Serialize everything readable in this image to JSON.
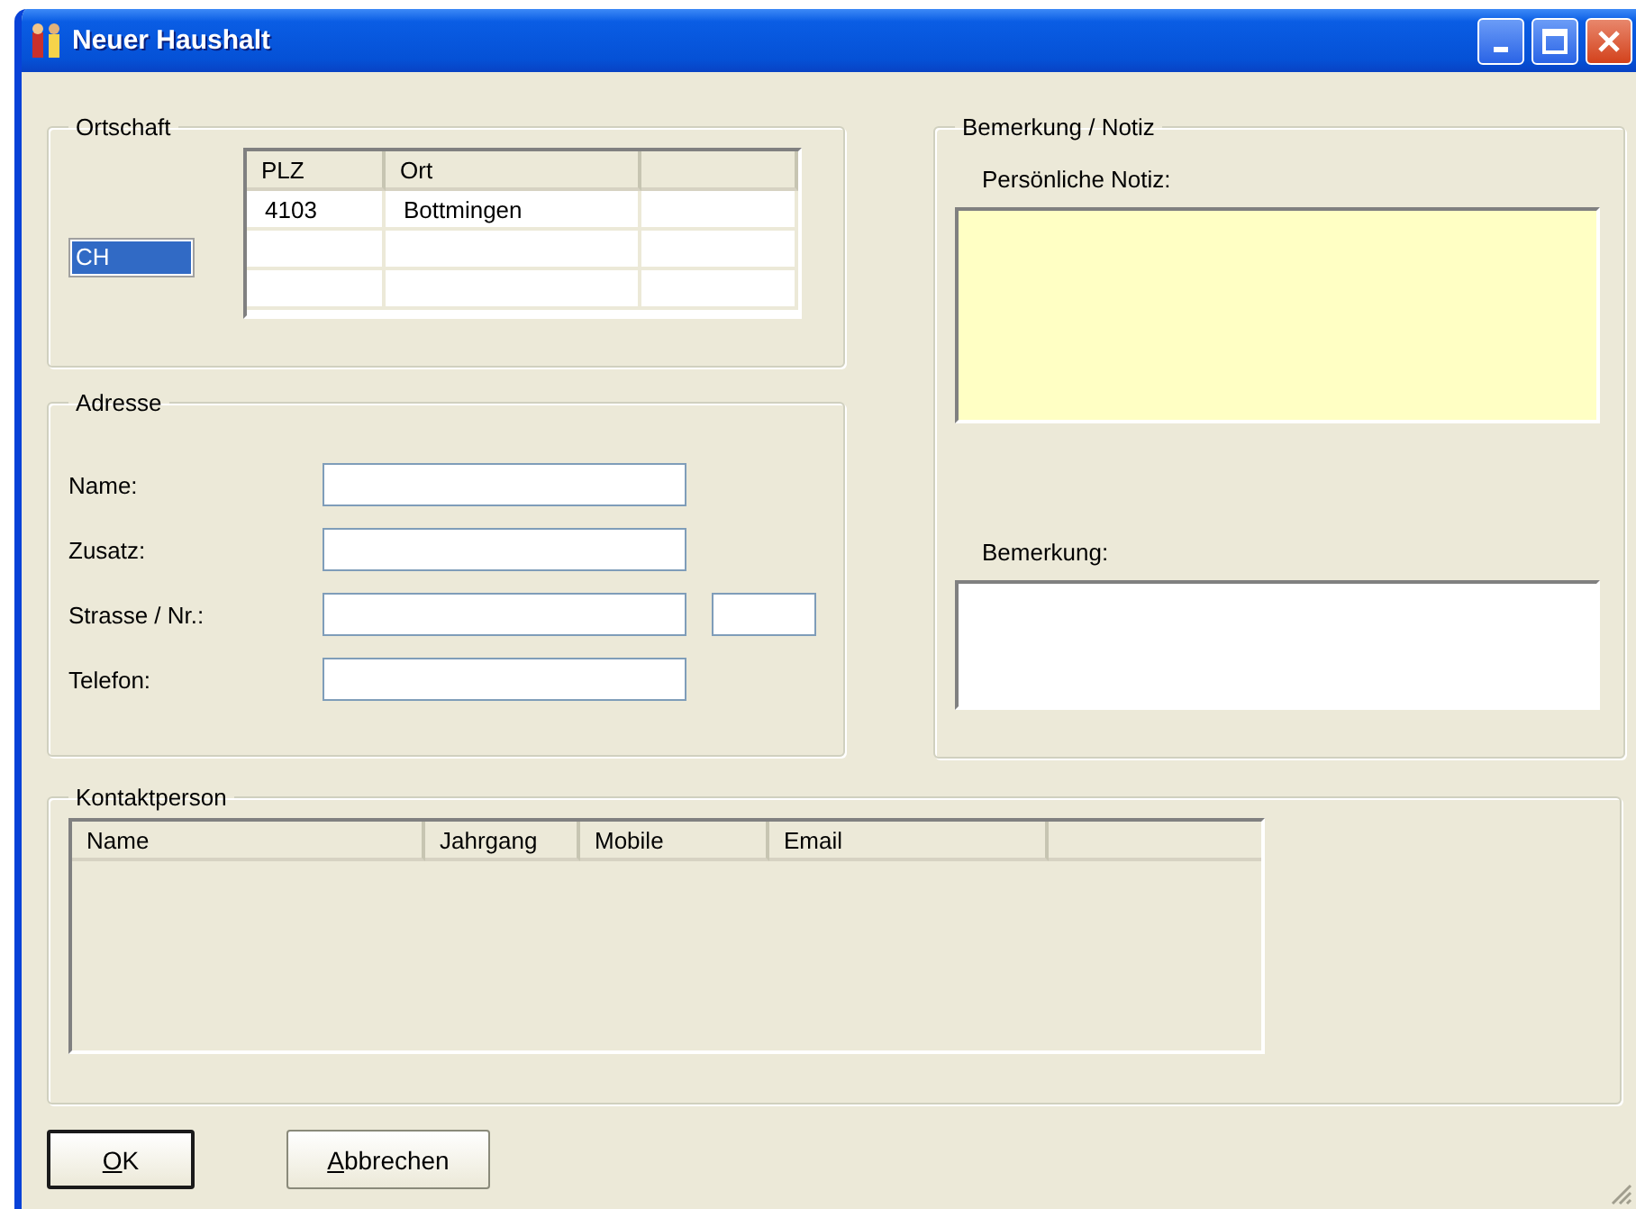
{
  "window": {
    "title": "Neuer Haushalt"
  },
  "ortschaft": {
    "title": "Ortschaft",
    "countries": [
      {
        "label": "CH",
        "selected": true
      }
    ],
    "columns": [
      "PLZ",
      "Ort"
    ],
    "rows": [
      [
        "4103",
        "Bottmingen"
      ]
    ]
  },
  "adresse": {
    "title": "Adresse",
    "fields": [
      {
        "label": "Name:",
        "kind": "text"
      },
      {
        "label": "Zusatz:",
        "kind": "text"
      },
      {
        "label": "Strasse / Nr.:",
        "kind": "street"
      },
      {
        "label": "Telefon:",
        "kind": "text"
      }
    ]
  },
  "notes": {
    "title": "Bemerkung / Notiz",
    "personal_label": "Persönliche Notiz:",
    "remark_label": "Bemerkung:"
  },
  "contacts": {
    "title": "Kontaktperson",
    "columns": [
      "Name",
      "Jahrgang",
      "Mobile",
      "Email"
    ]
  },
  "buttons": [
    {
      "mnemonic": "O",
      "rest": "K",
      "default": true
    },
    {
      "mnemonic": "A",
      "rest": "bbrechen",
      "default": false
    }
  ]
}
